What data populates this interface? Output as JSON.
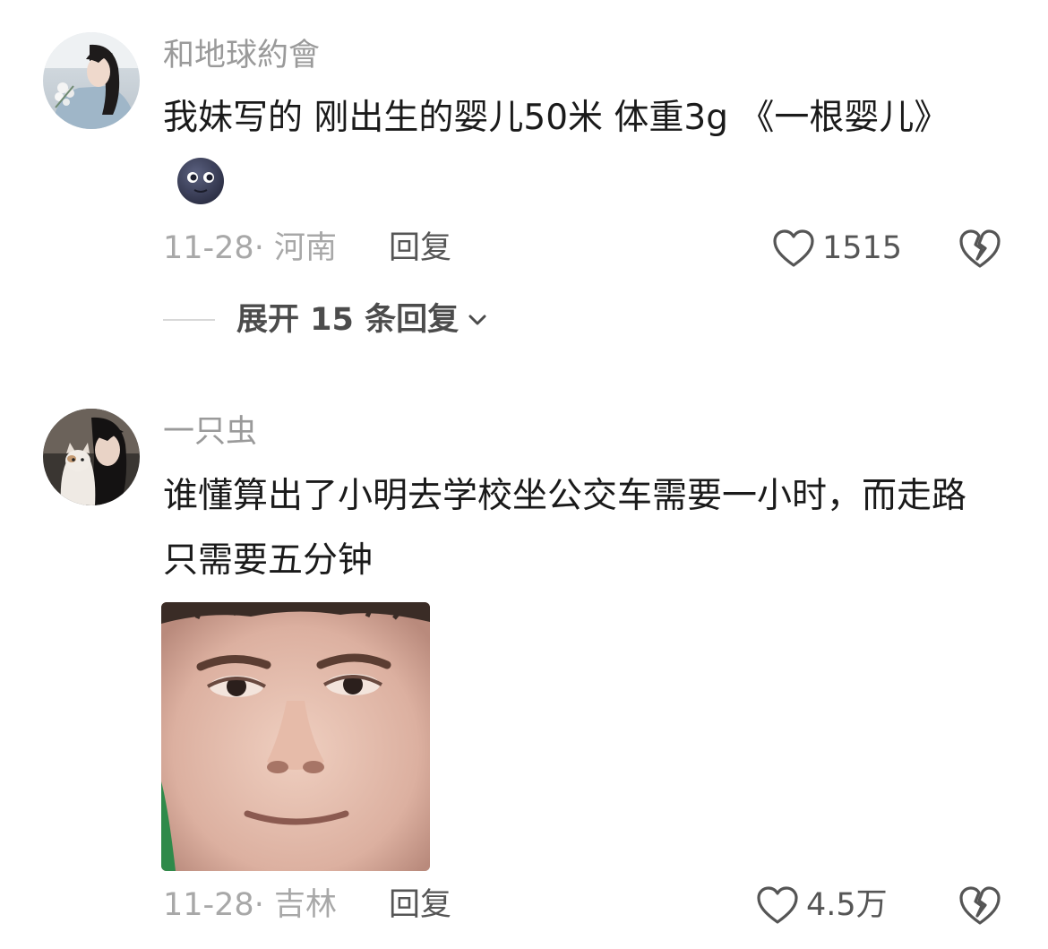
{
  "comments": [
    {
      "username": "和地球約會",
      "text": "我妹写的 刚出生的婴儿50米 体重3g  《一根婴儿》",
      "emoji_icon": "new-moon-face-emoji",
      "date_location": "11-28· 河南",
      "reply_label": "回复",
      "like_count": "1515",
      "expand_replies_label": "展开 15 条回复"
    },
    {
      "username": "一只虫",
      "text": "谁懂算出了小明去学校坐公交车需要一小时，而走路只需要五分钟",
      "date_location": "11-28· 吉林",
      "reply_label": "回复",
      "like_count": "4.5万"
    }
  ],
  "icons": {
    "like": "heart-outline-icon",
    "dislike": "broken-heart-icon",
    "expand": "chevron-down-icon"
  },
  "colors": {
    "username": "#9a9a9a",
    "meta": "#a8a8a8",
    "action": "#555555",
    "text": "#1a1a1a"
  }
}
